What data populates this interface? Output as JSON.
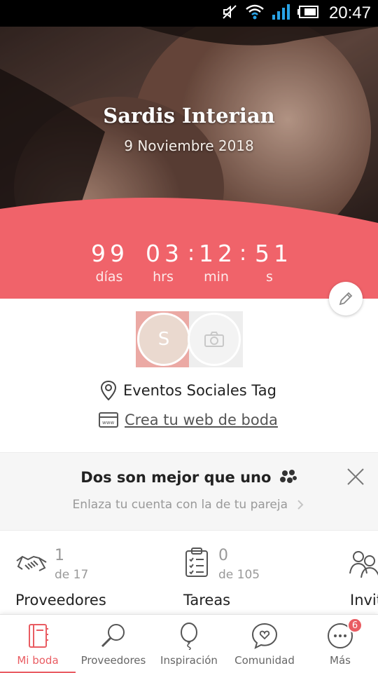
{
  "status_bar": {
    "time": "20:47",
    "icons": [
      "mute-icon",
      "wifi-icon",
      "signal-icon",
      "battery-icon"
    ]
  },
  "hero": {
    "couple_name": "Sardis Interian",
    "wedding_date": "9 Noviembre 2018",
    "countdown": {
      "days": "99",
      "days_label": "días",
      "hours": "03",
      "hours_label": "hrs",
      "minutes": "12",
      "minutes_label": "min",
      "seconds": "51",
      "seconds_label": "s"
    },
    "accent_color": "#f0636a"
  },
  "profile": {
    "avatar_initial": "S",
    "venue": "Eventos Sociales Tag",
    "web_link": "Crea tu web de boda"
  },
  "promo": {
    "title": "Dos son mejor que uno",
    "subtitle": "Enlaza tu cuenta con la de tu pareja"
  },
  "stats": [
    {
      "count": "1",
      "total": "de 17",
      "label": "Proveedores",
      "icon": "handshake-icon"
    },
    {
      "count": "0",
      "total": "de 105",
      "label": "Tareas",
      "icon": "checklist-icon"
    },
    {
      "label": "Invit",
      "icon": "guests-icon"
    }
  ],
  "bottom_nav": [
    {
      "label": "Mi boda",
      "icon": "notebook-icon",
      "active": true
    },
    {
      "label": "Proveedores",
      "icon": "magnifier-icon"
    },
    {
      "label": "Inspiración",
      "icon": "balloon-icon"
    },
    {
      "label": "Comunidad",
      "icon": "chat-heart-icon"
    },
    {
      "label": "Más",
      "icon": "more-icon",
      "badge": "6"
    }
  ]
}
